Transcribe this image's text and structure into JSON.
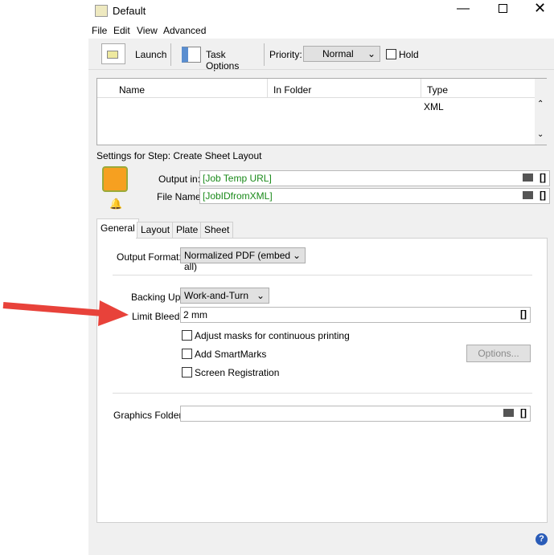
{
  "window": {
    "title": "Default"
  },
  "menu": [
    "File",
    "Edit",
    "View",
    "Advanced"
  ],
  "toolbar": {
    "launch": "Launch",
    "task_options": "Task Options",
    "priority_label": "Priority:",
    "priority_value": "Normal",
    "hold_label": "Hold"
  },
  "table": {
    "headers": [
      "Name",
      "In Folder",
      "Type"
    ],
    "rows": [
      {
        "name": "",
        "folder": "",
        "type": "XML"
      }
    ]
  },
  "step": {
    "title": "Settings for Step: Create Sheet Layout",
    "output_label": "Output in:",
    "output_value": "[Job Temp URL]",
    "filename_label": "File Name:",
    "filename_value": "[JobIDfromXML]"
  },
  "tabs": [
    "General",
    "Layout",
    "Plate",
    "Sheet"
  ],
  "general": {
    "output_format_label": "Output Format:",
    "output_format_value": "Normalized PDF (embed all)",
    "backing_label": "Backing Up:",
    "backing_value": "Work-and-Turn",
    "bleed_label": "Limit Bleed:",
    "bleed_value": "2 mm",
    "adjust_masks": "Adjust masks for continuous printing",
    "smartmarks": "Add SmartMarks",
    "options_button": "Options...",
    "screen_reg": "Screen Registration",
    "graphics_label": "Graphics Folder:",
    "graphics_value": ""
  },
  "colors": {
    "arrow": "#e8423a",
    "green_text": "#1a8a1a"
  }
}
